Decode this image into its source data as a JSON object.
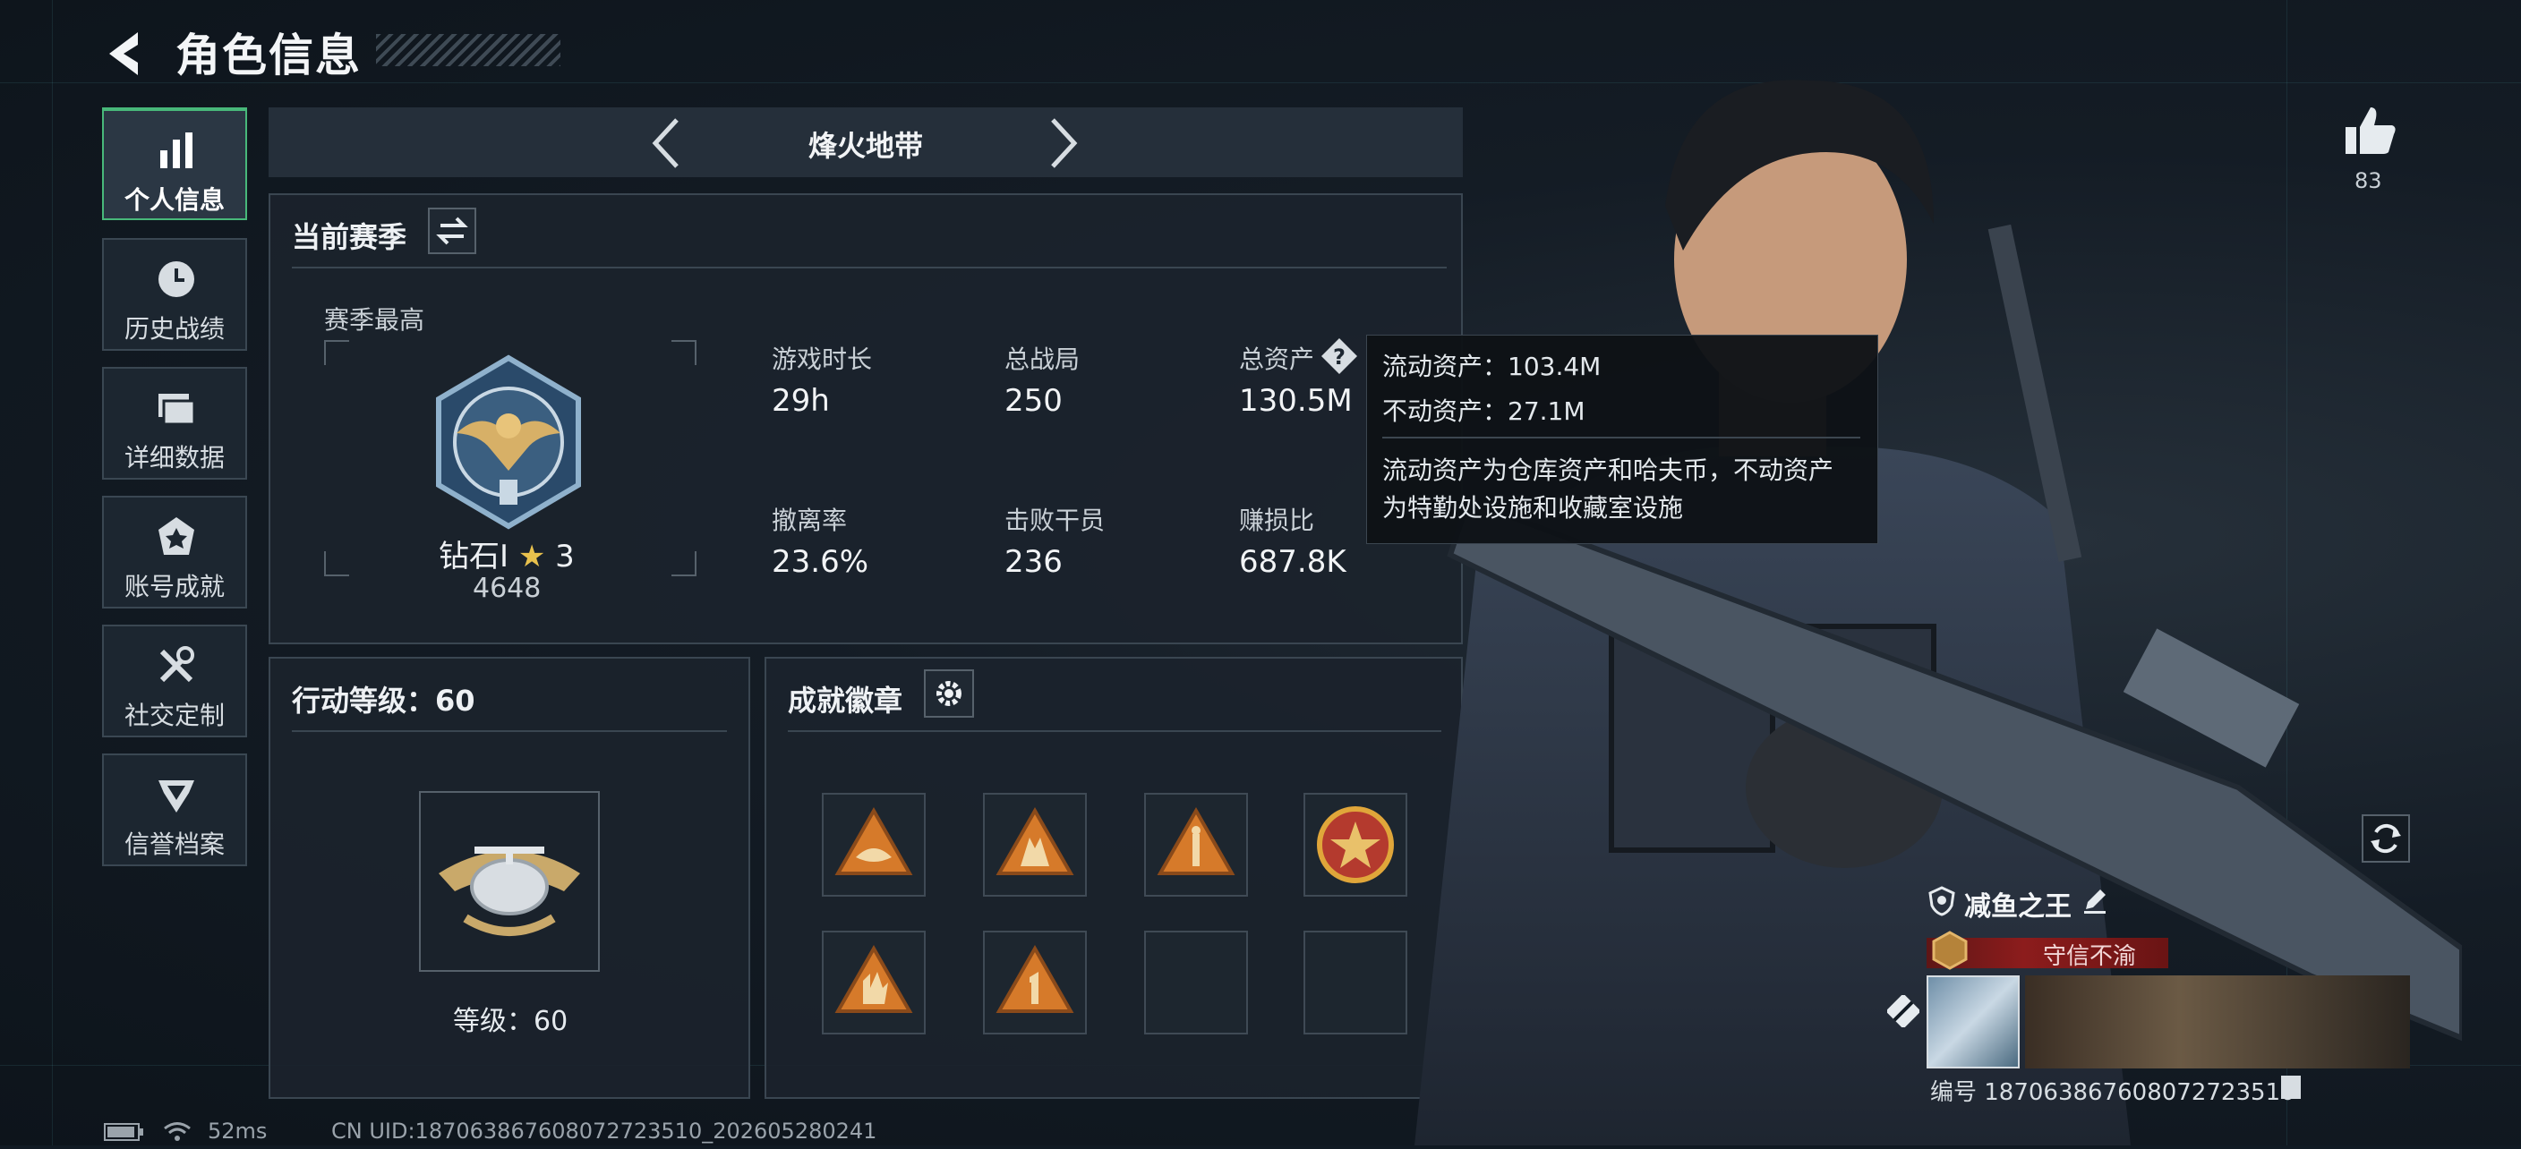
{
  "header": {
    "title": "角色信息"
  },
  "sidebar": {
    "items": [
      {
        "label": "个人信息",
        "icon": "bar-chart-icon",
        "active": true
      },
      {
        "label": "历史战绩",
        "icon": "clock-icon",
        "active": false
      },
      {
        "label": "详细数据",
        "icon": "folder-icon",
        "active": false
      },
      {
        "label": "账号成就",
        "icon": "badge-icon",
        "active": false
      },
      {
        "label": "社交定制",
        "icon": "tools-icon",
        "active": false
      },
      {
        "label": "信誉档案",
        "icon": "shield-wing-icon",
        "active": false
      }
    ]
  },
  "mode": {
    "label": "烽火地带"
  },
  "season": {
    "title": "当前赛季",
    "best_label": "赛季最高",
    "rank_name": "钻石Ⅰ",
    "rank_stars": "3",
    "rank_score": "4648",
    "stats": [
      {
        "label": "游戏时长",
        "value": "29h"
      },
      {
        "label": "总战局",
        "value": "250"
      },
      {
        "label": "总资产",
        "value": "130.5M"
      },
      {
        "label": "撤离率",
        "value": "23.6%"
      },
      {
        "label": "击败干员",
        "value": "236"
      },
      {
        "label": "赚损比",
        "value": "687.8K"
      }
    ]
  },
  "tooltip": {
    "line1": "流动资产：103.4M",
    "line2": "不动资产：27.1M",
    "line3": "流动资产为仓库资产和哈夫币，不动资产",
    "line4": "为特勤处设施和收藏室设施"
  },
  "action_level": {
    "title": "行动等级：60",
    "level_text": "等级：60"
  },
  "achievements": {
    "title": "成就徽章"
  },
  "likes": {
    "count": "83"
  },
  "player": {
    "name": "减鱼之王",
    "reputation": "守信不渝",
    "id_text": "编号 187063867608072723510"
  },
  "footer": {
    "ping": "52ms",
    "uid": "CN UID:187063867608072723510_202605280241"
  },
  "colors": {
    "accent_green": "#48b87a",
    "reputation_red": "#8c1c1c",
    "badge_orange": "#d67a2a"
  }
}
